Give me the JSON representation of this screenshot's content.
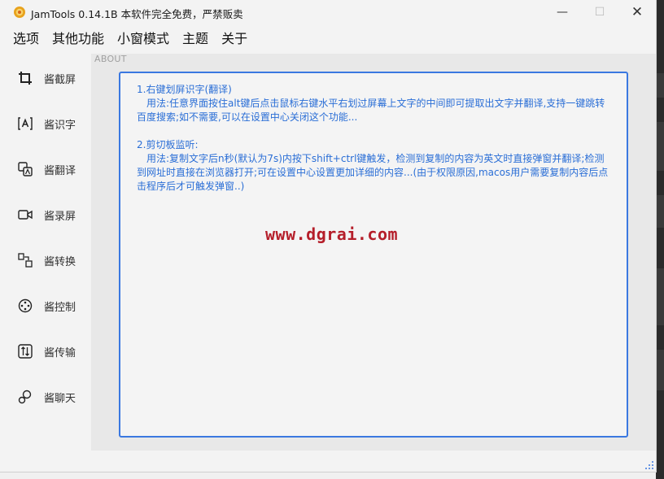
{
  "window": {
    "title": "JamTools 0.14.1B 本软件完全免费，严禁贩卖",
    "minimize_glyph": "—",
    "maximize_glyph": "☐",
    "close_glyph": "✕"
  },
  "menu": [
    {
      "label": "选项"
    },
    {
      "label": "其他功能"
    },
    {
      "label": "小窗模式"
    },
    {
      "label": "主题"
    },
    {
      "label": "关于"
    }
  ],
  "sidebar": {
    "items": [
      {
        "label": "酱截屏",
        "icon": "crop-icon"
      },
      {
        "label": "酱识字",
        "icon": "text-recognition-icon"
      },
      {
        "label": "酱翻译",
        "icon": "translate-icon"
      },
      {
        "label": "酱录屏",
        "icon": "video-camera-icon"
      },
      {
        "label": "酱转换",
        "icon": "convert-icon"
      },
      {
        "label": "酱控制",
        "icon": "control-icon"
      },
      {
        "label": "酱传输",
        "icon": "transfer-icon"
      },
      {
        "label": "酱聊天",
        "icon": "chat-icon"
      }
    ]
  },
  "about": {
    "label": "ABOUT",
    "section1_title": "1.右键划屏识字(翻译)",
    "section1_body": "用法:任意界面按住alt键后点击鼠标右键水平右划过屏幕上文字的中间即可提取出文字并翻译,支持一键跳转百度搜索;如不需要,可以在设置中心关闭这个功能...",
    "section2_title": "2.剪切板监听:",
    "section2_body": "用法:复制文字后n秒(默认为7s)内按下shift+ctrl键触发，检测到复制的内容为英文时直接弹窗并翻译;检测到网址时直接在浏览器打开;可在设置中心设置更加详细的内容...(由于权限原因,macos用户需要复制内容后点击程序后才可触发弹窗..)",
    "watermark": "www.dgrai.com"
  },
  "colors": {
    "accent": "#3a78e0",
    "info_text": "#2a6ed6",
    "watermark": "#b51e2a"
  }
}
